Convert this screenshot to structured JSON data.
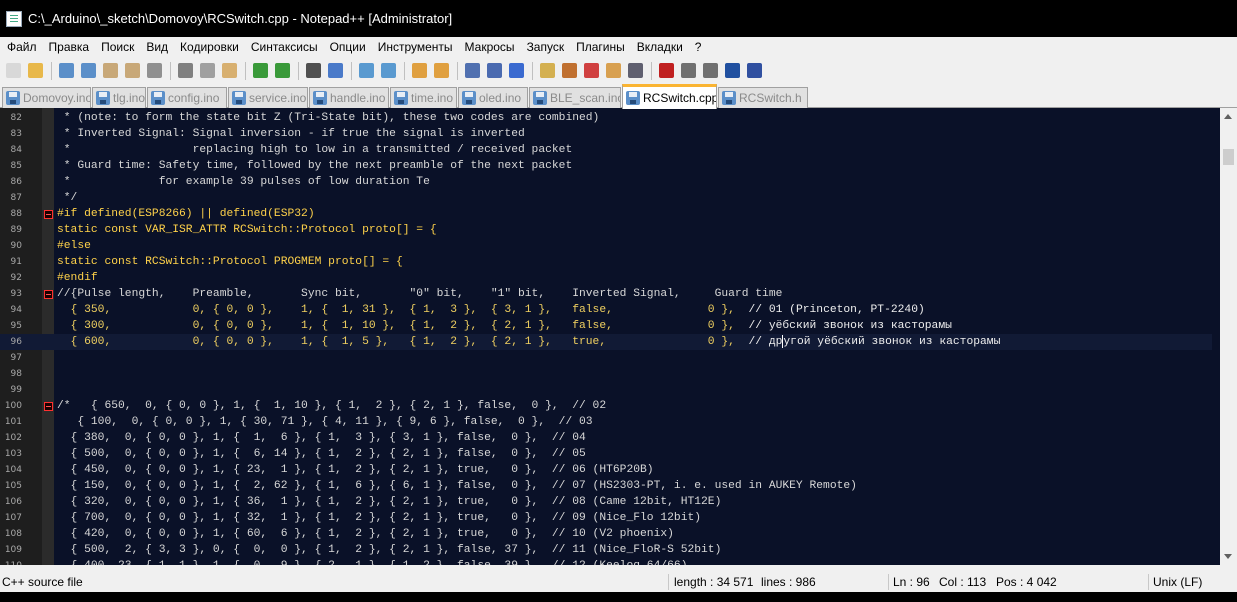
{
  "window": {
    "title": "C:\\_Arduino\\_sketch\\Domovoy\\RCSwitch.cpp - Notepad++ [Administrator]"
  },
  "menu": [
    "Файл",
    "Правка",
    "Поиск",
    "Вид",
    "Кодировки",
    "Синтаксисы",
    "Опции",
    "Инструменты",
    "Макросы",
    "Запуск",
    "Плагины",
    "Вкладки",
    "?"
  ],
  "toolbar": {
    "buttons": [
      "new-file-icon",
      "open-file-icon",
      "save-icon",
      "save-all-icon",
      "close-icon",
      "close-all-icon",
      "print-icon",
      "cut-icon",
      "copy-icon",
      "paste-icon",
      "undo-icon",
      "redo-icon",
      "find-icon",
      "replace-icon",
      "zoom-in-icon",
      "zoom-out-icon",
      "sync-vertical-icon",
      "sync-horizontal-icon",
      "word-wrap-icon",
      "show-all-chars-icon",
      "indent-guide-icon",
      "user-language-icon",
      "document-map-icon",
      "function-list-icon",
      "folder-workspace-icon",
      "monitor-icon",
      "record-macro-icon",
      "stop-macro-icon",
      "play-macro-icon",
      "play-multiple-icon",
      "save-macro-icon"
    ]
  },
  "tabs": [
    {
      "label": "Domovoy.ino",
      "active": false
    },
    {
      "label": "tlg.ino",
      "active": false
    },
    {
      "label": "config.ino",
      "active": false
    },
    {
      "label": "service.ino",
      "active": false
    },
    {
      "label": "handle.ino",
      "active": false
    },
    {
      "label": "time.ino",
      "active": false
    },
    {
      "label": "oled.ino",
      "active": false
    },
    {
      "label": "BLE_scan.ino",
      "active": false
    },
    {
      "label": "RCSwitch.cpp",
      "active": true
    },
    {
      "label": "RCSwitch.h",
      "active": false
    }
  ],
  "editor": {
    "lines": [
      {
        "n": "82",
        "text": " * (note: to form the state bit Z (Tri-State bit), these two codes are combined)",
        "kind": "comment"
      },
      {
        "n": "83",
        "text": " * Inverted Signal: Signal inversion - if true the signal is inverted",
        "kind": "comment"
      },
      {
        "n": "84",
        "text": " *                  replacing high to low in a transmitted / received packet",
        "kind": "comment"
      },
      {
        "n": "85",
        "text": " * Guard time: Safety time, followed by the next preamble of the next packet",
        "kind": "comment"
      },
      {
        "n": "86",
        "text": " *             for example 39 pulses of low duration Te",
        "kind": "comment"
      },
      {
        "n": "87",
        "text": " */",
        "kind": "comment"
      },
      {
        "n": "88",
        "text": "#if defined(ESP8266) || defined(ESP32)",
        "kind": "pre",
        "fold": true
      },
      {
        "n": "89",
        "text": "static const VAR_ISR_ATTR RCSwitch::Protocol proto[] = {",
        "kind": "pre"
      },
      {
        "n": "90",
        "text": "#else",
        "kind": "pre"
      },
      {
        "n": "91",
        "text": "static const RCSwitch::Protocol PROGMEM proto[] = {",
        "kind": "pre"
      },
      {
        "n": "92",
        "text": "#endif",
        "kind": "pre"
      },
      {
        "n": "93",
        "text": "//{Pulse length,    Preamble,       Sync bit,       \"0\" bit,    \"1\" bit,    Inverted Signal,     Guard time",
        "kind": "comment",
        "fold": true
      },
      {
        "n": "94",
        "text": "  { 350,            0, { 0, 0 },    1, {  1, 31 },  { 1,  3 },  { 3, 1 },   false,              0 },",
        "tail": "  // 01 (Princeton, PT-2240)",
        "kind": "data"
      },
      {
        "n": "95",
        "text": "  { 300,            0, { 0, 0 },    1, {  1, 10 },  { 1,  2 },  { 2, 1 },   false,              0 },",
        "tail": "  // уёбский звонок из касторамы",
        "kind": "data"
      },
      {
        "n": "96",
        "text": "  { 600,            0, { 0, 0 },    1, {  1, 5 },   { 1,  2 },  { 2, 1 },   true,               0 },",
        "tail": "  // другой уёбский звонок из касторамы",
        "kind": "data",
        "current": true
      },
      {
        "n": "97",
        "text": "",
        "kind": "comment"
      },
      {
        "n": "98",
        "text": "",
        "kind": "comment"
      },
      {
        "n": "99",
        "text": "",
        "kind": "comment"
      },
      {
        "n": "100",
        "text": "/*   { 650,  0, { 0, 0 }, 1, {  1, 10 }, { 1,  2 }, { 2, 1 }, false,  0 },  // 02",
        "kind": "comment",
        "fold": true
      },
      {
        "n": "101",
        "text": "   { 100,  0, { 0, 0 }, 1, { 30, 71 }, { 4, 11 }, { 9, 6 }, false,  0 },  // 03",
        "kind": "comment"
      },
      {
        "n": "102",
        "text": "  { 380,  0, { 0, 0 }, 1, {  1,  6 }, { 1,  3 }, { 3, 1 }, false,  0 },  // 04",
        "kind": "comment"
      },
      {
        "n": "103",
        "text": "  { 500,  0, { 0, 0 }, 1, {  6, 14 }, { 1,  2 }, { 2, 1 }, false,  0 },  // 05",
        "kind": "comment"
      },
      {
        "n": "104",
        "text": "  { 450,  0, { 0, 0 }, 1, { 23,  1 }, { 1,  2 }, { 2, 1 }, true,   0 },  // 06 (HT6P20B)",
        "kind": "comment"
      },
      {
        "n": "105",
        "text": "  { 150,  0, { 0, 0 }, 1, {  2, 62 }, { 1,  6 }, { 6, 1 }, false,  0 },  // 07 (HS2303-PT, i. e. used in AUKEY Remote)",
        "kind": "comment"
      },
      {
        "n": "106",
        "text": "  { 320,  0, { 0, 0 }, 1, { 36,  1 }, { 1,  2 }, { 2, 1 }, true,   0 },  // 08 (Came 12bit, HT12E)",
        "kind": "comment"
      },
      {
        "n": "107",
        "text": "  { 700,  0, { 0, 0 }, 1, { 32,  1 }, { 1,  2 }, { 2, 1 }, true,   0 },  // 09 (Nice_Flo 12bit)",
        "kind": "comment"
      },
      {
        "n": "108",
        "text": "  { 420,  0, { 0, 0 }, 1, { 60,  6 }, { 1,  2 }, { 2, 1 }, true,   0 },  // 10 (V2 phoenix)",
        "kind": "comment"
      },
      {
        "n": "109",
        "text": "  { 500,  2, { 3, 3 }, 0, {  0,  0 }, { 1,  2 }, { 2, 1 }, false, 37 },  // 11 (Nice_FloR-S 52bit)",
        "kind": "comment"
      },
      {
        "n": "110",
        "text": "  { 400, 23, { 1, 1 }, 1, {  0,  9 }, { 2,  1 }, { 1, 2 }, false, 39 },  // 12 (Keeloq 64/66)",
        "kind": "comment"
      }
    ]
  },
  "status": {
    "file_type": "C++ source file",
    "length": "length : 34 571",
    "lines": "lines : 986",
    "ln": "Ln : 96",
    "col": "Col : 113",
    "pos": "Pos : 4 042",
    "eol": "Unix (LF)"
  },
  "colors": {
    "editor_bg": "#0a1128",
    "comment": "#d8d8d8",
    "preprocessor": "#ffd24a",
    "tab_accent": "#fab432",
    "fold_marker": "#ff3030"
  }
}
